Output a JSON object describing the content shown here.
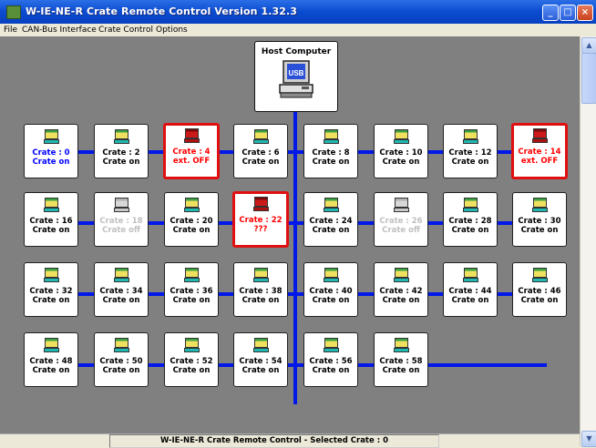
{
  "window": {
    "title": "W-IE-NE-R Crate Remote Control Version 1.32.3",
    "buttons": {
      "minimize": "_",
      "maximize": "□",
      "close": "×"
    }
  },
  "menu": [
    "File",
    "CAN-Bus Interface",
    "Crate Control",
    "Options"
  ],
  "host": {
    "label": "Host Computer",
    "icon": "host-computer-usb-icon",
    "icon_text": "USB"
  },
  "crates": [
    {
      "line1": "Crate : 0",
      "line2": "Crate on",
      "state": "on",
      "selected": false,
      "text_color": "#0000ff"
    },
    {
      "line1": "Crate : 2",
      "line2": "Crate on",
      "state": "on",
      "selected": false,
      "text_color": "#000000"
    },
    {
      "line1": "Crate : 4",
      "line2": "ext. OFF",
      "state": "off",
      "selected": true,
      "text_color": "#ff0000"
    },
    {
      "line1": "Crate : 6",
      "line2": "Crate on",
      "state": "on",
      "selected": false,
      "text_color": "#000000"
    },
    {
      "line1": "Crate : 8",
      "line2": "Crate on",
      "state": "on",
      "selected": false,
      "text_color": "#000000"
    },
    {
      "line1": "Crate : 10",
      "line2": "Crate on",
      "state": "on",
      "selected": false,
      "text_color": "#000000"
    },
    {
      "line1": "Crate : 12",
      "line2": "Crate on",
      "state": "on",
      "selected": false,
      "text_color": "#000000"
    },
    {
      "line1": "Crate : 14",
      "line2": "ext. OFF",
      "state": "off",
      "selected": true,
      "text_color": "#ff0000"
    },
    {
      "line1": "Crate : 16",
      "line2": "Crate on",
      "state": "on",
      "selected": false,
      "text_color": "#000000"
    },
    {
      "line1": "Crate : 18",
      "line2": "Crate off",
      "state": "disabled",
      "selected": false,
      "text_color": "#c0c0c0"
    },
    {
      "line1": "Crate : 20",
      "line2": "Crate on",
      "state": "on",
      "selected": false,
      "text_color": "#000000"
    },
    {
      "line1": "Crate : 22",
      "line2": "???",
      "state": "off",
      "selected": true,
      "text_color": "#ff0000"
    },
    {
      "line1": "Crate : 24",
      "line2": "Crate on",
      "state": "on",
      "selected": false,
      "text_color": "#000000"
    },
    {
      "line1": "Crate : 26",
      "line2": "Crate off",
      "state": "disabled",
      "selected": false,
      "text_color": "#c0c0c0"
    },
    {
      "line1": "Crate : 28",
      "line2": "Crate on",
      "state": "on",
      "selected": false,
      "text_color": "#000000"
    },
    {
      "line1": "Crate : 30",
      "line2": "Crate on",
      "state": "on",
      "selected": false,
      "text_color": "#000000"
    },
    {
      "line1": "Crate : 32",
      "line2": "Crate on",
      "state": "on",
      "selected": false,
      "text_color": "#000000"
    },
    {
      "line1": "Crate : 34",
      "line2": "Crate on",
      "state": "on",
      "selected": false,
      "text_color": "#000000"
    },
    {
      "line1": "Crate : 36",
      "line2": "Crate on",
      "state": "on",
      "selected": false,
      "text_color": "#000000"
    },
    {
      "line1": "Crate : 38",
      "line2": "Crate on",
      "state": "on",
      "selected": false,
      "text_color": "#000000"
    },
    {
      "line1": "Crate : 40",
      "line2": "Crate on",
      "state": "on",
      "selected": false,
      "text_color": "#000000"
    },
    {
      "line1": "Crate : 42",
      "line2": "Crate on",
      "state": "on",
      "selected": false,
      "text_color": "#000000"
    },
    {
      "line1": "Crate : 44",
      "line2": "Crate on",
      "state": "on",
      "selected": false,
      "text_color": "#000000"
    },
    {
      "line1": "Crate : 46",
      "line2": "Crate on",
      "state": "on",
      "selected": false,
      "text_color": "#000000"
    },
    {
      "line1": "Crate : 48",
      "line2": "Crate on",
      "state": "on",
      "selected": false,
      "text_color": "#000000"
    },
    {
      "line1": "Crate : 50",
      "line2": "Crate on",
      "state": "on",
      "selected": false,
      "text_color": "#000000"
    },
    {
      "line1": "Crate : 52",
      "line2": "Crate on",
      "state": "on",
      "selected": false,
      "text_color": "#000000"
    },
    {
      "line1": "Crate : 54",
      "line2": "Crate on",
      "state": "on",
      "selected": false,
      "text_color": "#000000"
    },
    {
      "line1": "Crate : 56",
      "line2": "Crate on",
      "state": "on",
      "selected": false,
      "text_color": "#000000"
    },
    {
      "line1": "Crate : 58",
      "line2": "Crate on",
      "state": "on",
      "selected": false,
      "text_color": "#000000"
    }
  ],
  "icon_colors": {
    "on": {
      "screen": "#f0e060",
      "stripe": "#3aa040",
      "base": "#20b8b0"
    },
    "off": {
      "screen": "#cc1a1a",
      "stripe": "#7a0a0a",
      "base": "#aa1010"
    },
    "disabled": {
      "screen": "#d8d8d8",
      "stripe": "#b0b0b0",
      "base": "#c8c8c8"
    }
  },
  "colors": {
    "bus_line": "#0018e8",
    "background": "#808080",
    "selection_border": "#e01010"
  },
  "scrollbar": {
    "up": "▲",
    "down": "▼"
  },
  "status": {
    "text": "W-IE-NE-R Crate Remote Control    -    Selected Crate : 0"
  }
}
